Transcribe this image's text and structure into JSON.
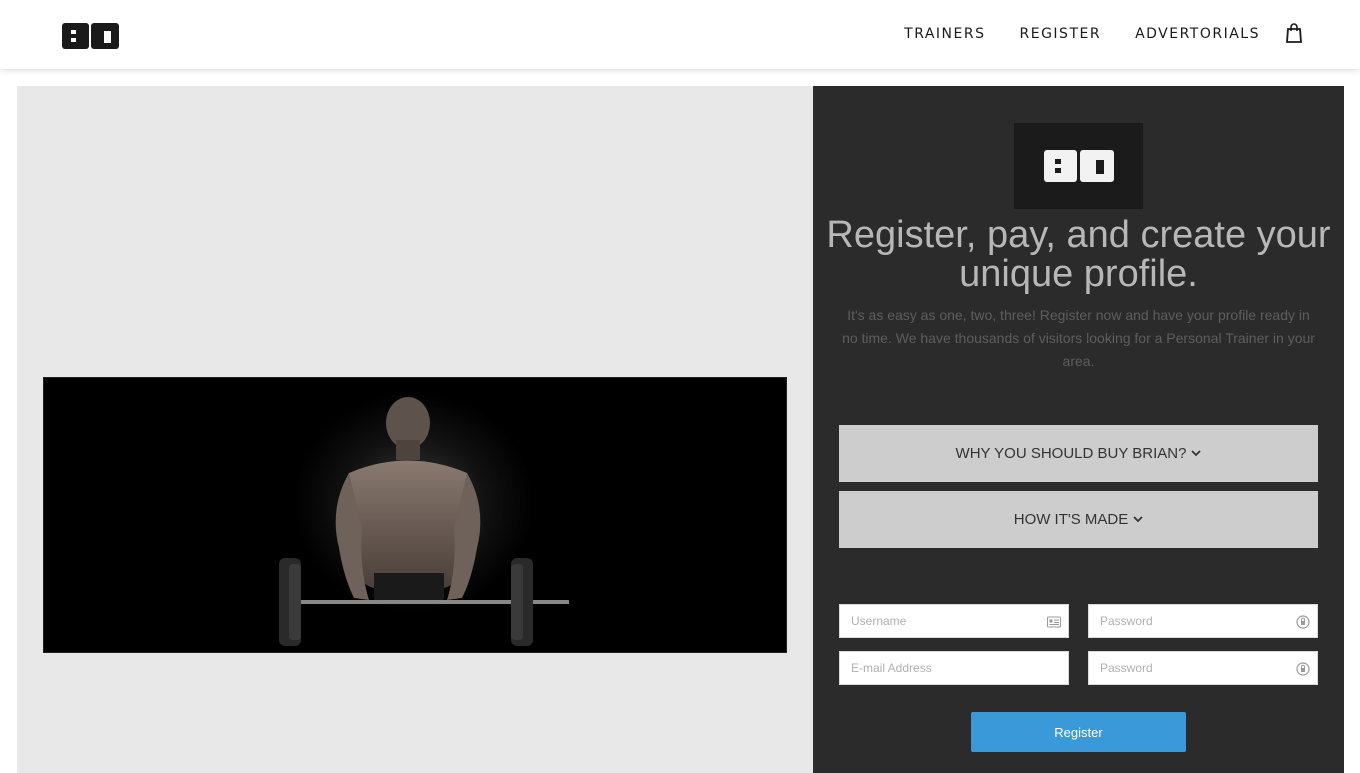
{
  "brand": {
    "logo_text": "BO"
  },
  "nav": {
    "items": [
      {
        "label": "TRAINERS"
      },
      {
        "label": "REGISTER"
      },
      {
        "label": "ADVERTORIALS"
      }
    ],
    "cart_icon": "shopping-bag-icon"
  },
  "hero": {
    "image": "bodybuilder-barbell-curl"
  },
  "register_panel": {
    "title": "Register, pay, and create your unique profile.",
    "description": "It's as easy as one, two, three! Register now and have your profile ready in no time. We have thousands of visitors looking for a Personal Trainer in your area.",
    "accordions": [
      {
        "label": "WHY YOU SHOULD BUY BRIAN?",
        "icon": "chevron-down-icon"
      },
      {
        "label": "HOW IT'S MADE",
        "icon": "chevron-down-icon"
      }
    ],
    "form": {
      "username_placeholder": "Username",
      "password_placeholder": "Password",
      "email_placeholder": "E-mail Address",
      "password_confirm_placeholder": "Password",
      "submit_label": "Register"
    }
  },
  "colors": {
    "panel_bg": "#2b2b2b",
    "left_bg": "#e8e8e8",
    "accordion_bg": "#cdcdcd",
    "button_bg": "#3a9ad9"
  }
}
